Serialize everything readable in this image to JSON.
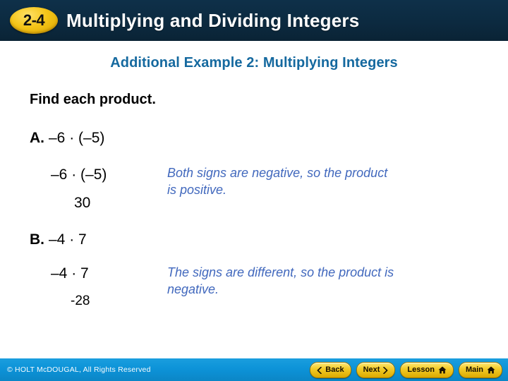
{
  "header": {
    "badge_number": "2-4",
    "title": "Multiplying and Dividing Integers",
    "background_color": "#0c2a40",
    "badge_color": "#f5c518"
  },
  "slide": {
    "subtitle": "Additional Example 2: Multiplying Integers",
    "subtitle_color": "#15699f",
    "instruction": "Find each product.",
    "problems": [
      {
        "letter": "A.",
        "expression": "–6 · (–5)",
        "work_expression": "–6 · (–5)",
        "answer": "30",
        "explanation": "Both signs are negative, so the product is positive.",
        "explanation_color": "#4168bd"
      },
      {
        "letter": "B.",
        "expression": "–4 · 7",
        "work_expression": "–4 · 7",
        "answer": "-28",
        "explanation": "The signs are different, so the product is negative.",
        "explanation_color": "#4168bd"
      }
    ]
  },
  "footer": {
    "copyright": "© HOLT McDOUGAL, All Rights Reserved",
    "background_color": "#0d93d8",
    "buttons": [
      {
        "label": "Back",
        "icon": "chevron-left-icon"
      },
      {
        "label": "Next",
        "icon": "chevron-right-icon"
      },
      {
        "label": "Lesson",
        "icon": "home-icon"
      },
      {
        "label": "Main",
        "icon": "home-icon"
      }
    ]
  }
}
